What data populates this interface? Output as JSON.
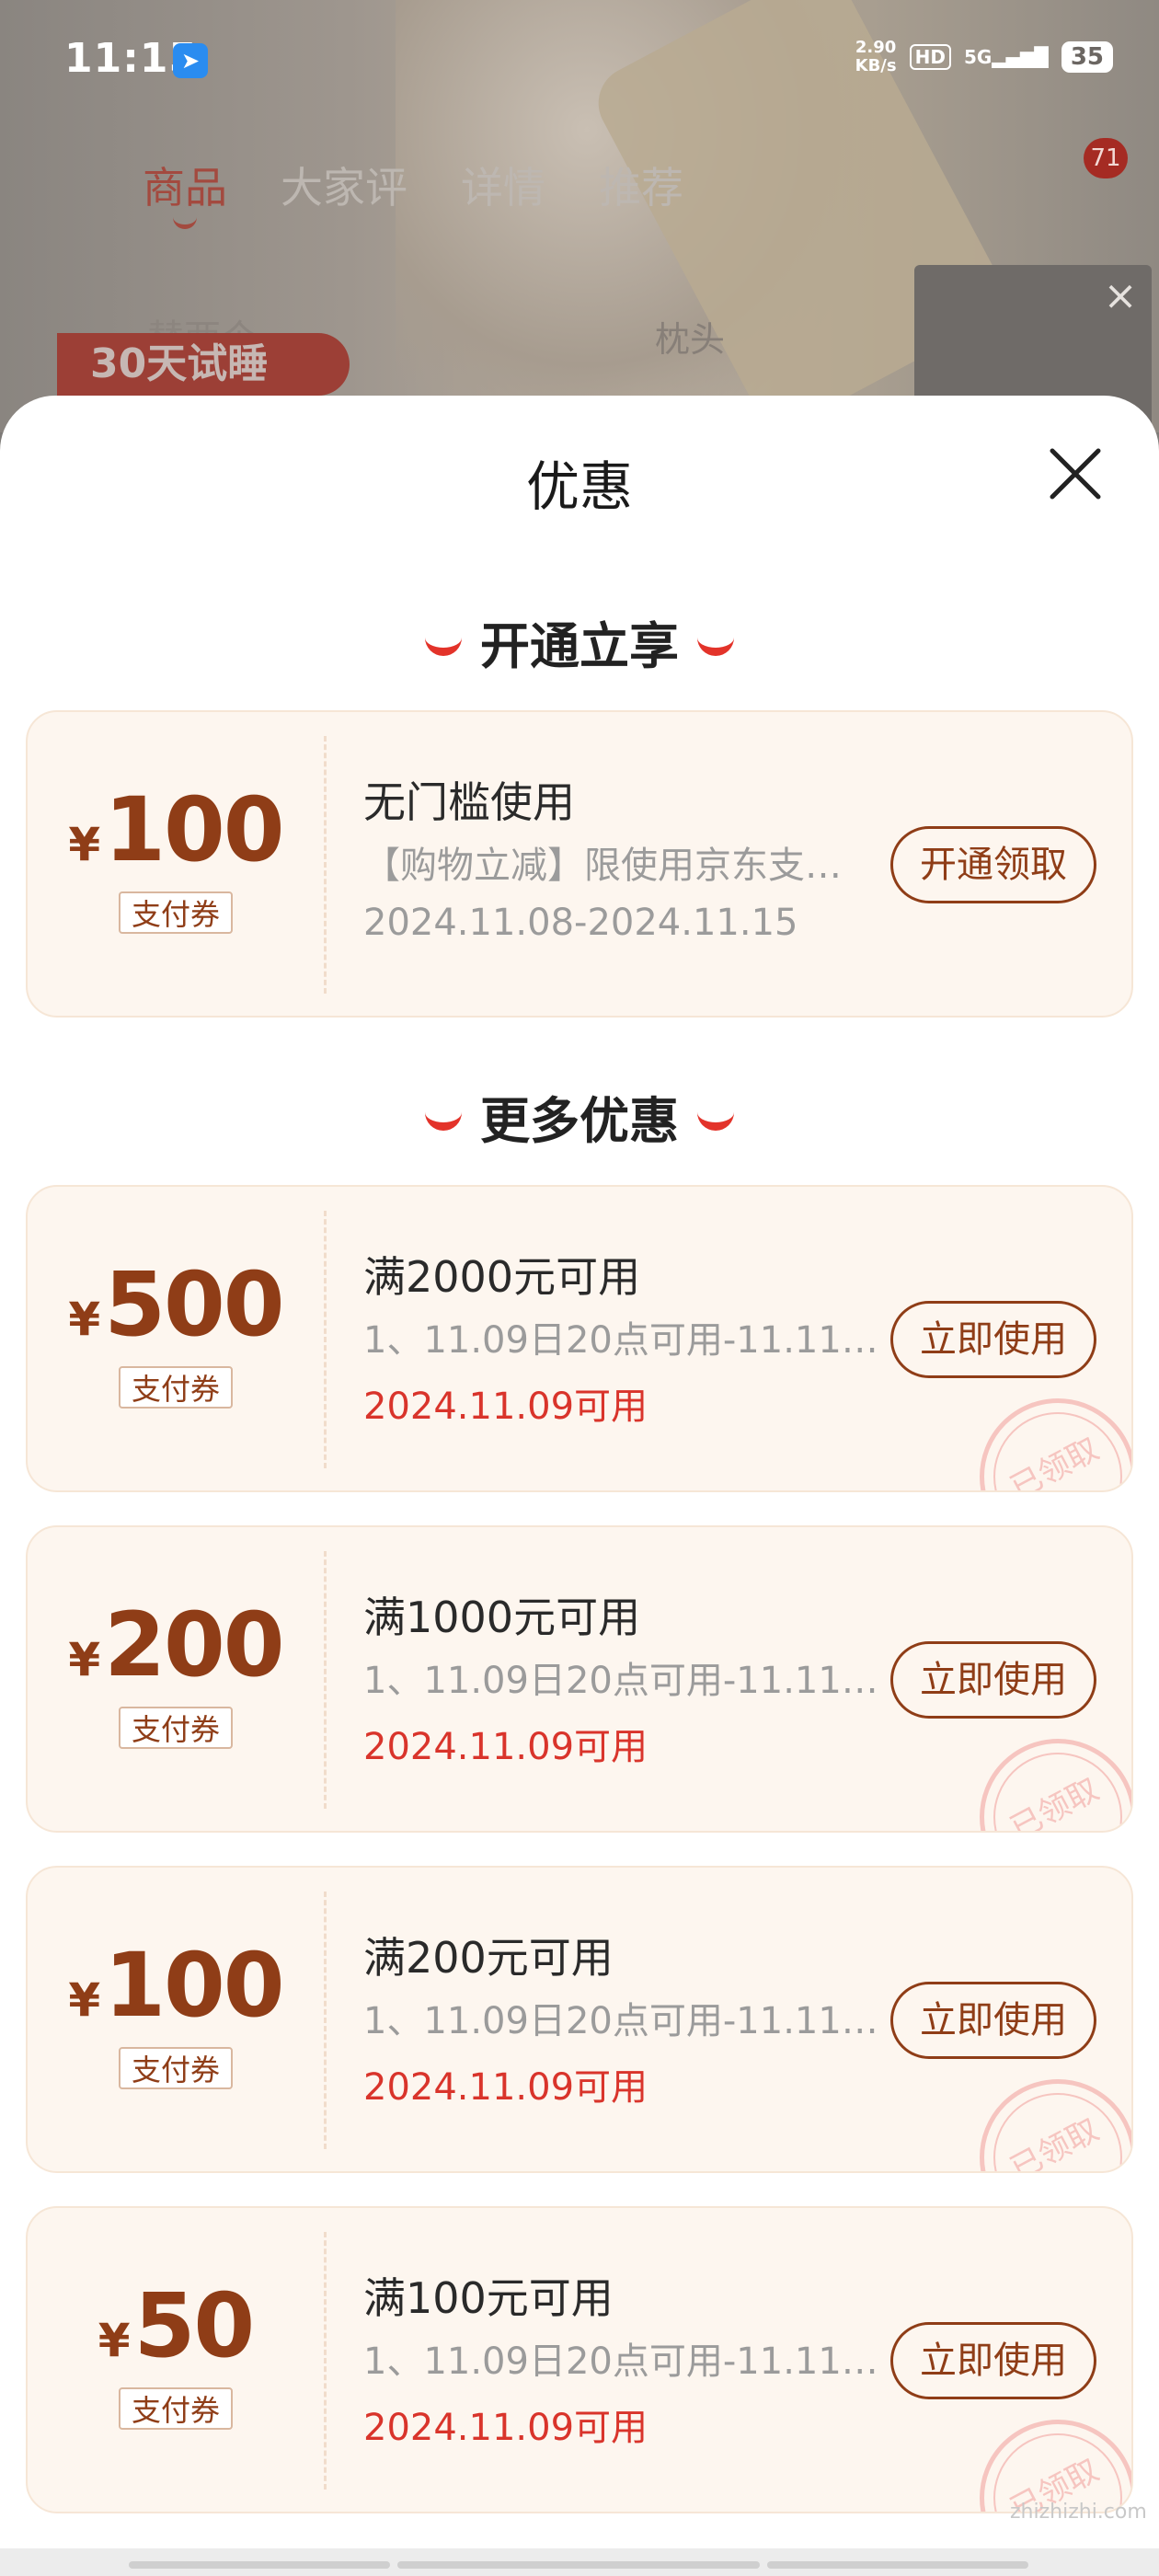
{
  "status_bar": {
    "time": "11:15",
    "net_speed": "2.90",
    "net_unit": "KB/s",
    "hd": "HD",
    "signal": "5G",
    "battery": "35"
  },
  "background_page": {
    "tabs": [
      "商品",
      "大家评",
      "详情",
      "推荐"
    ],
    "active_tab": "商品",
    "cart_count": "71",
    "promo_pill": "30天试睡",
    "pillow_label": "枕头",
    "sub_text": "替两个"
  },
  "sheet": {
    "title": "优惠",
    "sections": [
      {
        "heading": "开通立享",
        "coupons": [
          {
            "currency": "¥",
            "amount": "100",
            "tag": "支付券",
            "title": "无门槛使用",
            "desc": "【购物立减】限使用京东支…",
            "date": "2024.11.08-2024.11.15",
            "date_color": "grey",
            "button": "开通领取",
            "stamped": false
          }
        ]
      },
      {
        "heading": "更多优惠",
        "coupons": [
          {
            "currency": "¥",
            "amount": "500",
            "tag": "支付券",
            "title": "满2000元可用",
            "desc": "1、11.09日20点可用-11.11…",
            "date": "2024.11.09可用",
            "date_color": "red",
            "button": "立即使用",
            "stamped": true,
            "stamp_text": "已领取"
          },
          {
            "currency": "¥",
            "amount": "200",
            "tag": "支付券",
            "title": "满1000元可用",
            "desc": "1、11.09日20点可用-11.11…",
            "date": "2024.11.09可用",
            "date_color": "red",
            "button": "立即使用",
            "stamped": true,
            "stamp_text": "已领取"
          },
          {
            "currency": "¥",
            "amount": "100",
            "tag": "支付券",
            "title": "满200元可用",
            "desc": "1、11.09日20点可用-11.11…",
            "date": "2024.11.09可用",
            "date_color": "red",
            "button": "立即使用",
            "stamped": true,
            "stamp_text": "已领取"
          },
          {
            "currency": "¥",
            "amount": "50",
            "tag": "支付券",
            "title": "满100元可用",
            "desc": "1、11.09日20点可用-11.11…",
            "date": "2024.11.09可用",
            "date_color": "red",
            "button": "立即使用",
            "stamped": true,
            "stamp_text": "已领取"
          }
        ]
      }
    ]
  },
  "watermark": "zhizhizhi.com"
}
